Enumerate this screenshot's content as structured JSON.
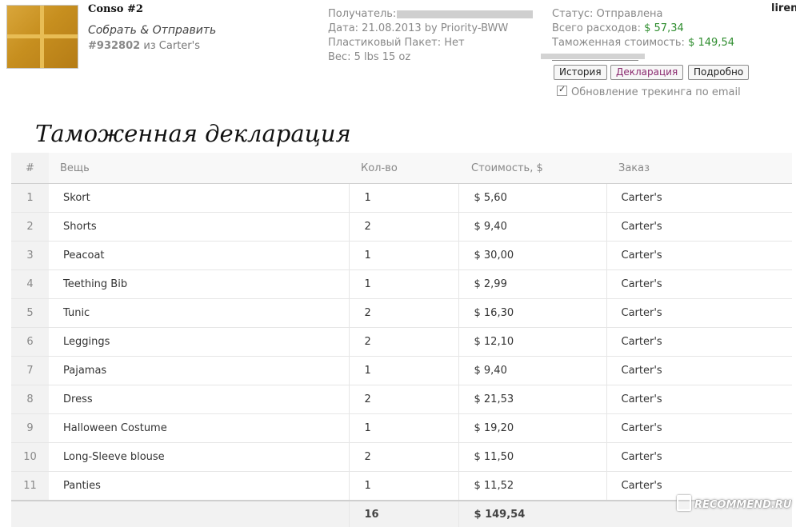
{
  "header": {
    "title": "Conso #2",
    "action": "Собрать & Отправить",
    "order_id": "#932802",
    "order_source": "из Carter's",
    "user": "liren"
  },
  "info": {
    "recipient_label": "Получатель:",
    "date_line": "Дата: 21.08.2013 by Priority-BWW",
    "bag_line": "Пластиковый Пакет: Нет",
    "weight_line": "Вес: 5 lbs 15 oz"
  },
  "status": {
    "status_line": "Статус: Отправлена",
    "total_label": "Всего расходов:",
    "total_value": "$ 57,34",
    "customs_label": "Таможенная стоимость:",
    "customs_value": "$ 149,54"
  },
  "buttons": {
    "history": "История",
    "declaration": "Декларация",
    "details": "Подробно"
  },
  "tracking": {
    "label": "Обновление трекинга по email",
    "checked": true
  },
  "declaration": {
    "title": "Таможенная декларация",
    "columns": {
      "num": "#",
      "item": "Вещь",
      "qty": "Кол-во",
      "cost": "Стоимость, $",
      "order": "Заказ"
    },
    "rows": [
      {
        "num": "1",
        "item": "Skort",
        "qty": "1",
        "cost": "$ 5,60",
        "order": "Carter's"
      },
      {
        "num": "2",
        "item": "Shorts",
        "qty": "2",
        "cost": "$ 9,40",
        "order": "Carter's"
      },
      {
        "num": "3",
        "item": "Peacoat",
        "qty": "1",
        "cost": "$ 30,00",
        "order": "Carter's"
      },
      {
        "num": "4",
        "item": "Teething Bib",
        "qty": "1",
        "cost": "$ 2,99",
        "order": "Carter's"
      },
      {
        "num": "5",
        "item": "Tunic",
        "qty": "2",
        "cost": "$ 16,30",
        "order": "Carter's"
      },
      {
        "num": "6",
        "item": "Leggings",
        "qty": "2",
        "cost": "$ 12,10",
        "order": "Carter's"
      },
      {
        "num": "7",
        "item": "Pajamas",
        "qty": "1",
        "cost": "$ 9,40",
        "order": "Carter's"
      },
      {
        "num": "8",
        "item": "Dress",
        "qty": "2",
        "cost": "$ 21,53",
        "order": "Carter's"
      },
      {
        "num": "9",
        "item": "Halloween Costume",
        "qty": "1",
        "cost": "$ 19,20",
        "order": "Carter's"
      },
      {
        "num": "10",
        "item": "Long-Sleeve blouse",
        "qty": "2",
        "cost": "$ 11,50",
        "order": "Carter's"
      },
      {
        "num": "11",
        "item": "Panties",
        "qty": "1",
        "cost": "$ 11,52",
        "order": "Carter's"
      }
    ],
    "totals": {
      "qty": "16",
      "cost": "$ 149,54"
    }
  },
  "watermark": "RECOMMEND.RU"
}
